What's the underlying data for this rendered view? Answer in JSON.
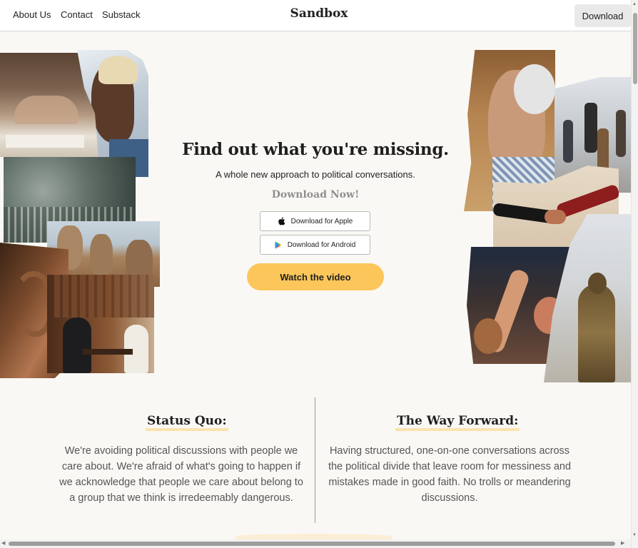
{
  "nav": {
    "links": [
      "About Us",
      "Contact",
      "Substack"
    ],
    "brand": "Sandbox",
    "download_label": "Download"
  },
  "hero": {
    "title": "Find out what you're missing.",
    "subtitle": "A whole new approach to political conversations.",
    "download_now": "Download Now!",
    "apple_label": "Download for Apple",
    "android_label": "Download for Android",
    "watch_label": "Watch the video",
    "accent_color": "#fcc65a"
  },
  "sections": {
    "status_quo": {
      "heading": "Status Quo:",
      "body": "We're avoiding political discussions with people we care about. We're afraid of what's going to happen if we acknowledge that people we care about belong to a group that we think is irredeemably dangerous."
    },
    "way_forward": {
      "heading": "The Way Forward:",
      "body": "Having structured, one-on-one conversations across the political divide that leave room for messiness and mistakes made in good faith. No trolls or meandering discussions."
    }
  },
  "collage": {
    "left": [
      "family-dinner-photo",
      "woman-profile-photo",
      "crowd-birds-photo",
      "mount-rushmore-photo",
      "ear-closeup-photo",
      "two-men-talking-photo"
    ],
    "right": [
      "older-man-photo",
      "people-walking-photo",
      "handshake-photo",
      "raised-hand-crowd-photo",
      "statue-photo"
    ]
  }
}
